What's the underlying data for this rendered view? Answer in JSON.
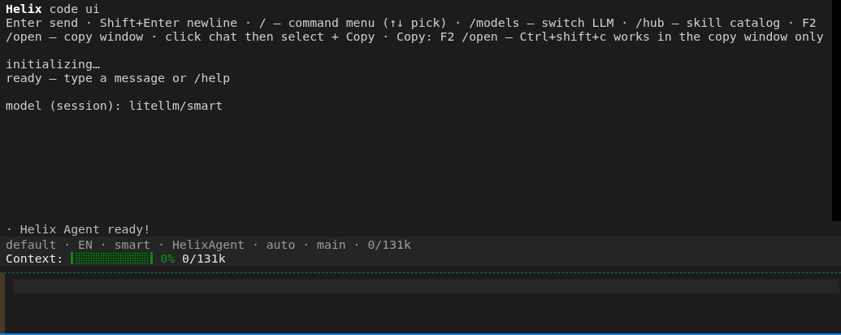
{
  "header": {
    "title": "Helix",
    "subtitle": "code ui"
  },
  "help_lines": [
    "Enter send · Shift+Enter newline · / — command menu (↑↓ pick) · /models — switch LLM · /hub — skill catalog · F2",
    "/open — copy window · click chat then select + Copy · Copy: F2 /open — Ctrl+shift+c works in the copy window only"
  ],
  "log_groups": [
    [
      "initializing…",
      "ready — type a message or /help"
    ],
    [
      "model (session): litellm/smart"
    ]
  ],
  "notice": "· Helix Agent ready!",
  "status_line": "default · EN · smart · HelixAgent · auto · main · 0/131k",
  "context": {
    "label": "Context:",
    "level": 0,
    "percent": "0%",
    "reading": "0/131k"
  }
}
